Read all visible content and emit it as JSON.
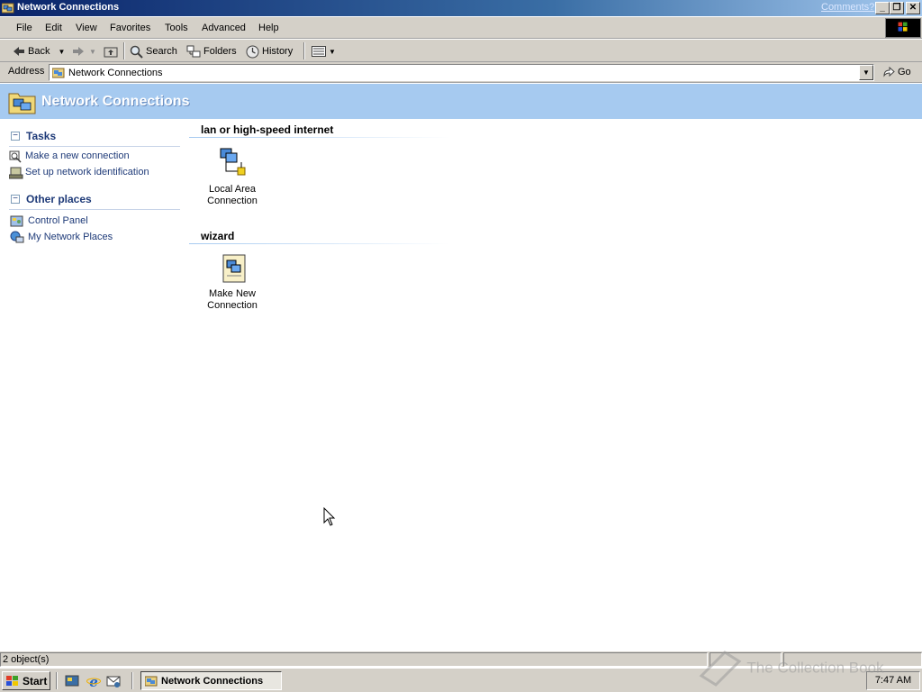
{
  "window": {
    "title": "Network Connections",
    "comments_link": "Comments?"
  },
  "menu": [
    "File",
    "Edit",
    "View",
    "Favorites",
    "Tools",
    "Advanced",
    "Help"
  ],
  "toolbar": {
    "back": "Back",
    "search": "Search",
    "folders": "Folders",
    "history": "History"
  },
  "address": {
    "label": "Address",
    "value": "Network Connections",
    "go": "Go"
  },
  "banner": {
    "title": "Network Connections"
  },
  "sidebar": {
    "tasks": {
      "title": "Tasks",
      "items": [
        "Make a new connection",
        "Set up network identification"
      ]
    },
    "other": {
      "title": "Other places",
      "items": [
        "Control Panel",
        "My Network Places"
      ]
    }
  },
  "groups": [
    {
      "title": "lan or high-speed internet",
      "item": {
        "line1": "Local Area",
        "line2": "Connection"
      }
    },
    {
      "title": "wizard",
      "item": {
        "line1": "Make New",
        "line2": "Connection"
      }
    }
  ],
  "status": {
    "objects": "2 object(s)"
  },
  "taskbar": {
    "start": "Start",
    "task": "Network Connections",
    "clock": "7:47 AM"
  },
  "watermark": "The Collection Book",
  "colors": {
    "title_start": "#0a246a",
    "banner": "#a6caf0",
    "link": "#1e3a78"
  }
}
